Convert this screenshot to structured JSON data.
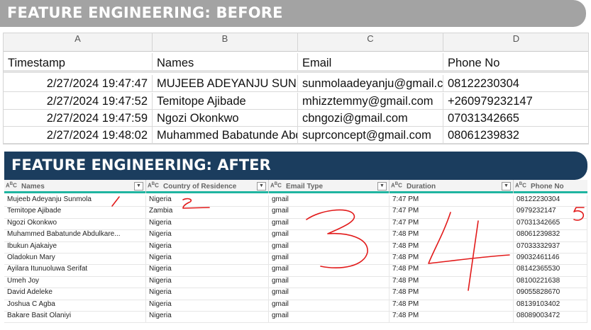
{
  "before": {
    "title": "FEATURE ENGINEERING: BEFORE",
    "column_letters": [
      "A",
      "B",
      "C",
      "D"
    ],
    "headers": [
      "Timestamp",
      "Names",
      "Email",
      "Phone No"
    ],
    "rows": [
      {
        "timestamp": "2/27/2024 19:47:47",
        "name": "MUJEEB ADEYANJU SUNMOLA",
        "email": "sunmolaadeyanju@gmail.com",
        "phone": "08122230304"
      },
      {
        "timestamp": "2/27/2024 19:47:52",
        "name": "Temitope Ajibade",
        "email": "mhizztemmy@gmail.com",
        "phone": "+260979232147"
      },
      {
        "timestamp": "2/27/2024 19:47:59",
        "name": "Ngozi Okonkwo",
        "email": "cbngozi@gmail.com",
        "phone": "07031342665"
      },
      {
        "timestamp": "2/27/2024 19:48:02",
        "name": "Muhammed Babatunde Abdulkareem",
        "email": "suprconcept@gmail.com",
        "phone": "08061239832"
      }
    ]
  },
  "after": {
    "title": "FEATURE ENGINEERING: AFTER",
    "type_icon": "ABC",
    "dropdown_icon": "▼",
    "headers": [
      "Names",
      "Country of Residence",
      "Email Type",
      "Duration",
      "Phone No"
    ],
    "rows": [
      {
        "name": "Mujeeb Adeyanju Sunmola",
        "country": "Nigeria",
        "email_type": "gmail",
        "duration": "7:47 PM",
        "phone": "08122230304"
      },
      {
        "name": "Temitope Ajibade",
        "country": "Zambia",
        "email_type": "gmail",
        "duration": "7:47 PM",
        "phone": "0979232147"
      },
      {
        "name": "Ngozi Okonkwo",
        "country": "Nigeria",
        "email_type": "gmail",
        "duration": "7:47 PM",
        "phone": "07031342665"
      },
      {
        "name": "Muhammed Babatunde Abdulkare...",
        "country": "Nigeria",
        "email_type": "gmail",
        "duration": "7:48 PM",
        "phone": "08061239832"
      },
      {
        "name": "Ibukun Ajakaiye",
        "country": "Nigeria",
        "email_type": "gmail",
        "duration": "7:48 PM",
        "phone": "07033332937"
      },
      {
        "name": "Oladokun Mary",
        "country": "Nigeria",
        "email_type": "gmail",
        "duration": "7:48 PM",
        "phone": "09032461146"
      },
      {
        "name": "Ayilara Itunuoluwa Serifat",
        "country": "Nigeria",
        "email_type": "gmail",
        "duration": "7:48 PM",
        "phone": "08142365530"
      },
      {
        "name": "Umeh Joy",
        "country": "Nigeria",
        "email_type": "gmail",
        "duration": "7:48 PM",
        "phone": "08100221638"
      },
      {
        "name": "David Adeleke",
        "country": "Nigeria",
        "email_type": "gmail",
        "duration": "7:48 PM",
        "phone": "09055828670"
      },
      {
        "name": "Joshua C Agba",
        "country": "Nigeria",
        "email_type": "gmail",
        "duration": "7:48 PM",
        "phone": "08139103402"
      },
      {
        "name": "Bakare Basit Olaniyi",
        "country": "Nigeria",
        "email_type": "gmail",
        "duration": "7:48 PM",
        "phone": "08089003472"
      }
    ]
  },
  "annotations": {
    "color": "#e21a1a",
    "digits": [
      "1",
      "2",
      "3",
      "4",
      "5"
    ]
  },
  "colors": {
    "before_banner": "#a3a3a3",
    "after_banner": "#1b3d5e",
    "header_underline": "#1fb5a1"
  }
}
